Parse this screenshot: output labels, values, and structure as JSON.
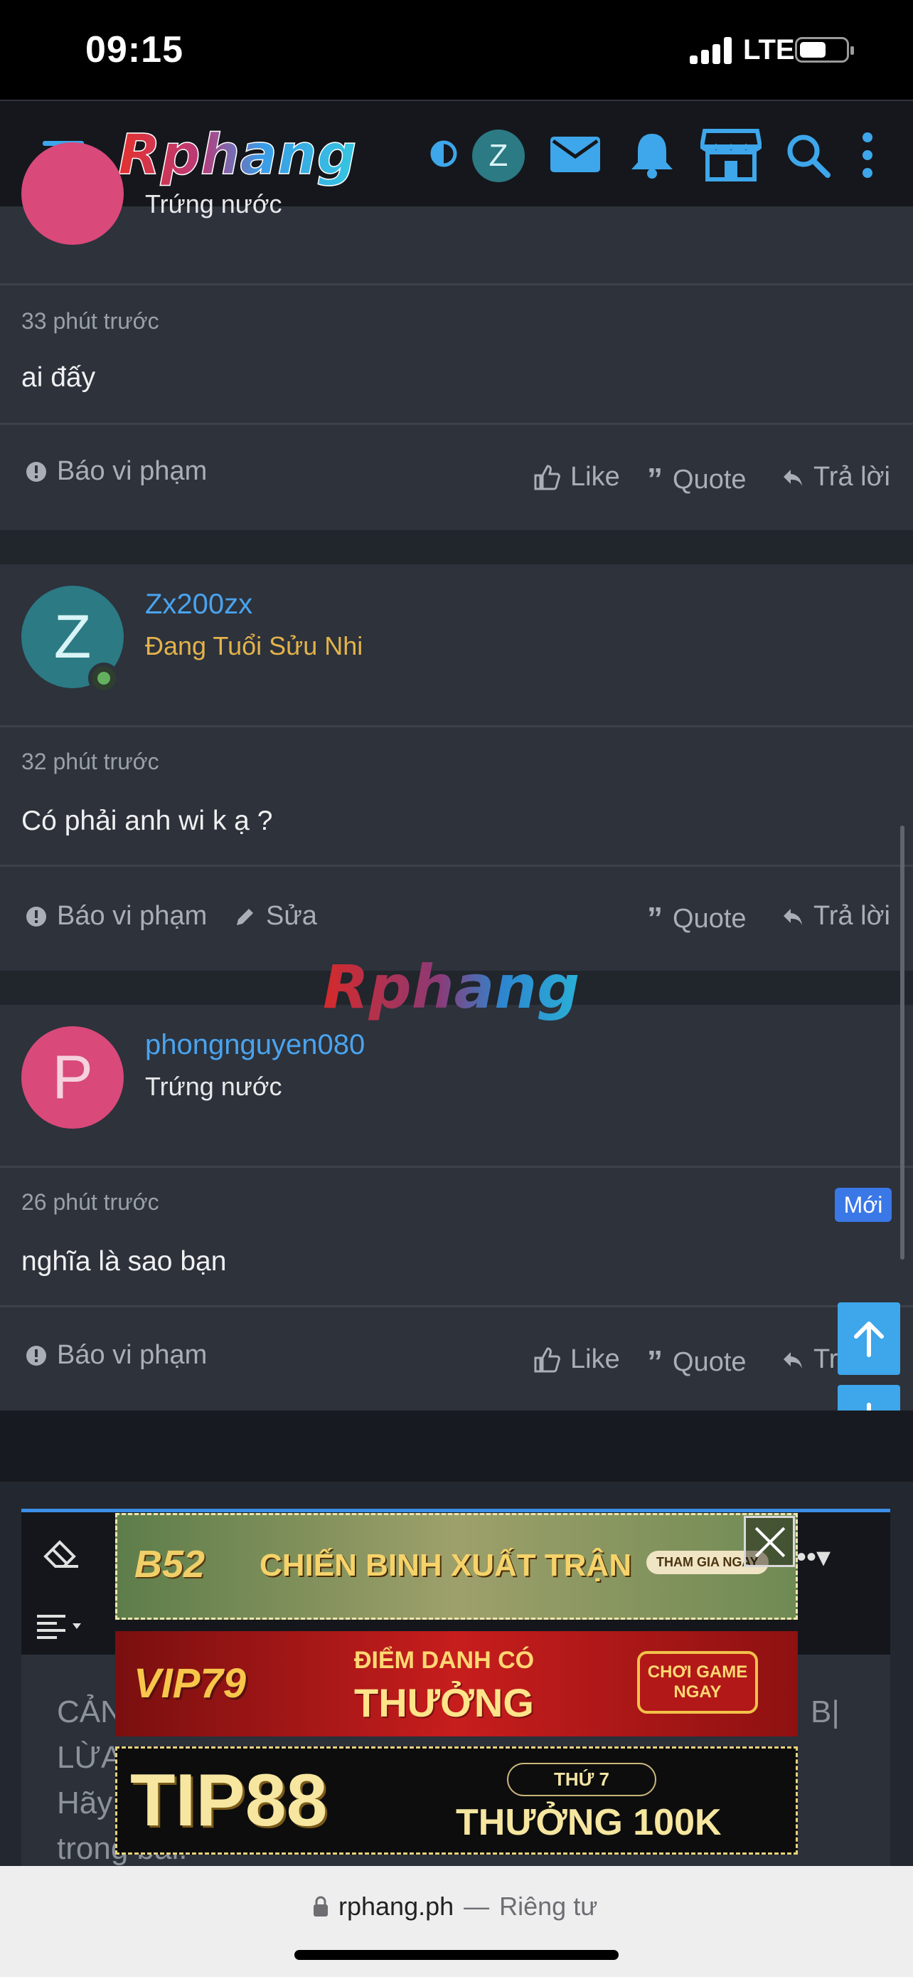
{
  "status_bar": {
    "time": "09:15",
    "network": "LTE",
    "battery_percent": 55
  },
  "site": {
    "logo_text": "Rphang",
    "avatar_letter": "Z"
  },
  "header_icons": [
    "menu-icon",
    "theme-toggle-icon",
    "mail-icon",
    "bell-icon",
    "store-icon",
    "search-icon",
    "more-icon"
  ],
  "posts": [
    {
      "partial_user_title": "Trứng nước",
      "time": "33 phút trước",
      "content": "ai đấy",
      "report": "Báo vi phạm",
      "like": "Like",
      "quote": "Quote",
      "reply": "Trả lời"
    },
    {
      "avatar_letter": "Z",
      "username": "Zx200zx",
      "user_title": "Đang Tuổi Sửu Nhi",
      "time": "32 phút trước",
      "content": "Có phải anh wi k ạ ?",
      "report": "Báo vi phạm",
      "edit": "Sửa",
      "quote": "Quote",
      "reply": "Trả lời"
    },
    {
      "avatar_letter": "P",
      "username": "phongnguyen080",
      "user_title": "Trứng nước",
      "time": "26 phút trước",
      "badge": "Mới",
      "content": "nghĩa là sao bạn",
      "report": "Báo vi phạm",
      "like": "Like",
      "quote": "Quote",
      "reply": "Trả lời"
    }
  ],
  "watermark": "Rphang",
  "editor": {
    "placeholder_lines": [
      "CẢN",
      "LỪA",
      "Hãy",
      "trong bài."
    ],
    "right_fragment": "B|"
  },
  "ads": [
    {
      "brand": "B52",
      "headline": "CHIẾN BINH XUẤT TRẬN",
      "cta": "THAM GIA NGAY"
    },
    {
      "brand": "VIP79",
      "headline": "ĐIỂM DANH CÓ",
      "headline2": "THƯỞNG",
      "cta": "CHƠI GAME NGAY"
    },
    {
      "brand": "TIP88",
      "tag": "THỨ 7",
      "headline": "THƯỞNG 100K"
    }
  ],
  "browser": {
    "url": "rphang.ph",
    "separator": "—",
    "mode": "Riêng tư"
  },
  "colors": {
    "accent": "#3ea6ea",
    "username": "#4aa3ee",
    "title_gold": "#e3b34a",
    "badge": "#3b78e7",
    "post_bg": "#2d323b"
  }
}
